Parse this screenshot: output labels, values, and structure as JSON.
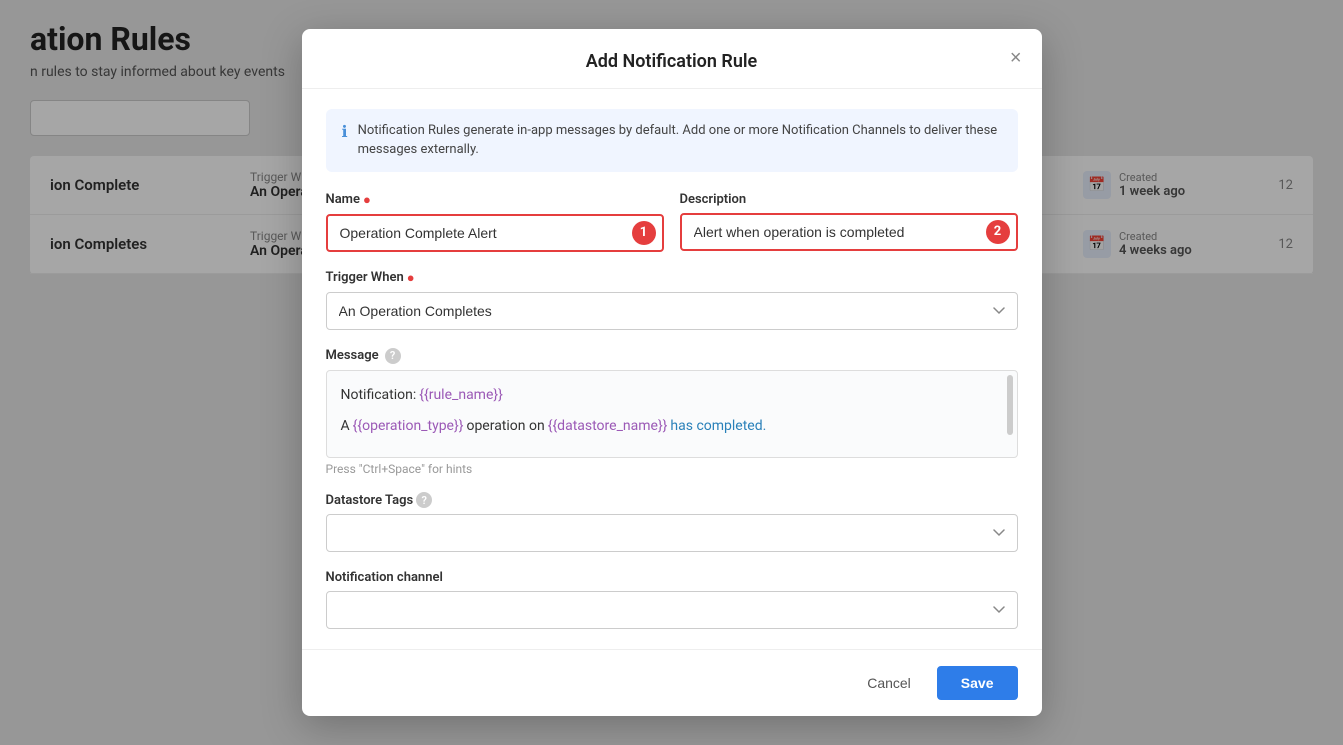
{
  "page": {
    "title": "ation Rules",
    "subtitle": "n rules to stay informed about key events"
  },
  "table": {
    "rows": [
      {
        "name": "ion Complete",
        "trigger_label": "Trigger When",
        "trigger_value": "An Operation",
        "created_label": "Created",
        "created_value": "1 week ago",
        "row_num": "12"
      },
      {
        "name": "ion Completes",
        "trigger_label": "Trigger When",
        "trigger_value": "An Operation",
        "created_label": "Created",
        "created_value": "4 weeks ago",
        "row_num": "12"
      }
    ]
  },
  "modal": {
    "title": "Add Notification Rule",
    "close_label": "×",
    "info_text": "Notification Rules generate in-app messages by default. Add one or more Notification Channels to deliver these messages externally.",
    "name_label": "Name",
    "name_required": true,
    "name_value": "Operation Complete Alert",
    "name_step": "1",
    "description_label": "Description",
    "description_value": "Alert when operation is completed",
    "description_step": "2",
    "trigger_label": "Trigger When",
    "trigger_required": true,
    "trigger_value": "An Operation Completes",
    "message_label": "Message",
    "message_line1_prefix": "Notification: ",
    "message_line1_var": "{{rule_name}}",
    "message_line2_prefix": "A ",
    "message_line2_var1": "{{operation_type}}",
    "message_line2_mid": " operation on ",
    "message_line2_var2": "{{datastore_name}}",
    "message_line2_suffix": " has completed.",
    "message_hint": "Press \"Ctrl+Space\" for hints",
    "datastore_tags_label": "Datastore Tags",
    "notification_channel_label": "Notification channel",
    "cancel_label": "Cancel",
    "save_label": "Save"
  }
}
